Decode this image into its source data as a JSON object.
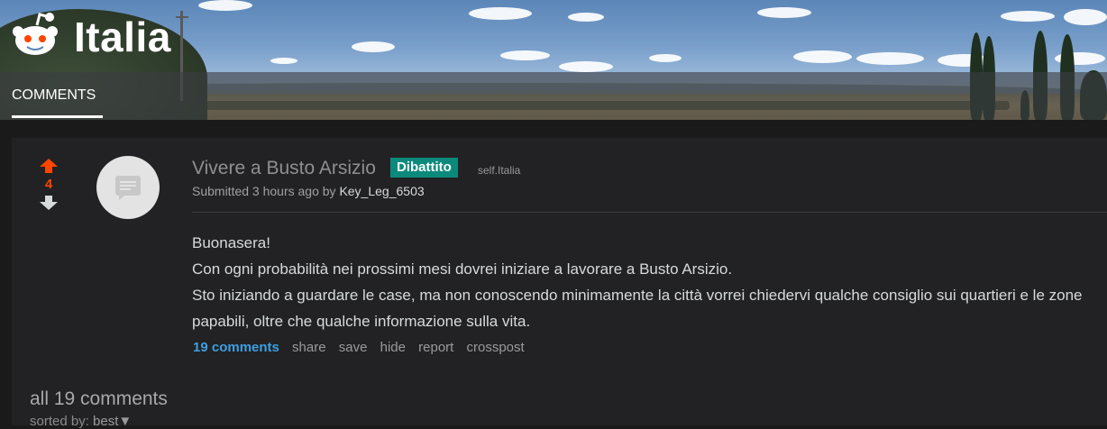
{
  "header": {
    "subreddit_title": "Italia",
    "tab_label": "COMMENTS"
  },
  "post": {
    "score": "4",
    "title": "Vivere a Busto Arsizio",
    "flair": "Dibattito",
    "domain": "self.Italia",
    "submitted_prefix": "Submitted 3 hours ago by ",
    "author": "Key_Leg_6503",
    "body": [
      "Buonasera!",
      "Con ogni probabilità nei prossimi mesi dovrei iniziare a lavorare a Busto Arsizio.",
      "Sto iniziando a guardare le case, ma non conoscendo minimamente la città vorrei chiedervi qualche consiglio sui quartieri e le zone papabili, oltre che qualche informazione sulla vita."
    ],
    "actions": {
      "comments": "19 comments",
      "share": "share",
      "save": "save",
      "hide": "hide",
      "report": "report",
      "crosspost": "crosspost"
    }
  },
  "comments_section": {
    "heading": "all 19 comments",
    "sorted_label": "sorted by: ",
    "sorted_value": "best",
    "sorted_caret": "▼"
  },
  "colors": {
    "upvote": "#ff4500",
    "flair_bg": "#0b8a7c",
    "link": "#3d9fe0",
    "background": "#1a1a1b"
  },
  "icons": {
    "logo": "reddit-alien-icon",
    "thumbnail": "self-post-text-icon",
    "upvote": "upvote-arrow-icon",
    "downvote": "downvote-arrow-icon"
  }
}
